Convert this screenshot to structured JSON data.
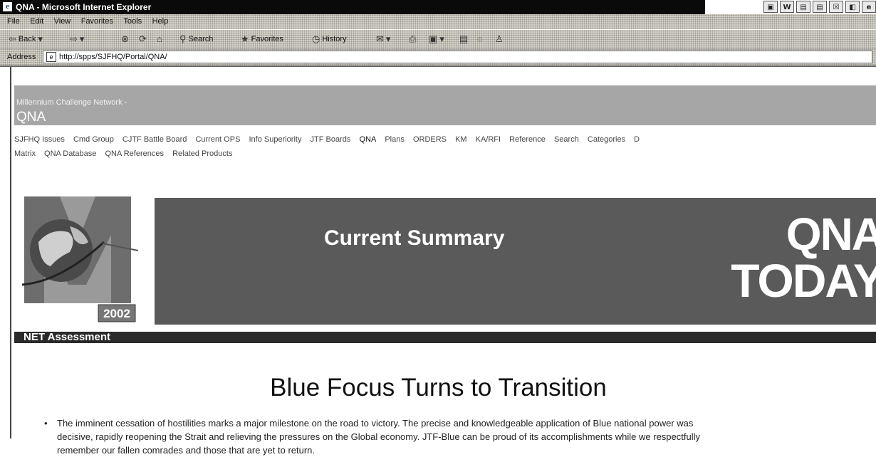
{
  "window": {
    "title": "QNA - Microsoft Internet Explorer",
    "ie_icon": "e",
    "controls": [
      "▣",
      "W",
      "▤",
      "▤",
      "☒",
      "◧",
      "e"
    ]
  },
  "menu": [
    "File",
    "Edit",
    "View",
    "Favorites",
    "Tools",
    "Help"
  ],
  "toolbar": {
    "back": "Back",
    "search": "Search",
    "favorites": "Favorites",
    "history": "History"
  },
  "address": {
    "label": "Address",
    "url": "http://spps/SJFHQ/Portal/QNA/"
  },
  "site": {
    "network": "Millennium Challenge Network -",
    "name": "QNA"
  },
  "nav": {
    "row1": [
      "SJFHQ Issues",
      "Cmd Group",
      "CJTF Battle Board",
      "Current OPS",
      "Info Superiority",
      "JTF Boards",
      "QNA",
      "Plans",
      "ORDERS",
      "KM",
      "KA/RFI",
      "Reference",
      "Search",
      "Categories",
      "D"
    ],
    "row2": [
      "Matrix",
      "QNA Database",
      "QNA References",
      "Related Products"
    ],
    "current": "QNA"
  },
  "logo": {
    "year": "2002"
  },
  "banner": {
    "title": "Current Summary",
    "logo_line1": "QNA",
    "logo_line2": "TODAY"
  },
  "section": {
    "title": "NET Assessment"
  },
  "headline": "Blue Focus Turns to Transition",
  "bullets": [
    {
      "lines": [
        "The imminent cessation of hostilities marks a major milestone on the road to victory.  The precise and knowledgeable application of Blue national power was",
        "decisive, rapidly reopening the Strait and relieving the pressures on the Global economy.  JTF-Blue can be proud of its accomplishments while we respectfully",
        "remember our fallen comrades and those that are yet to return."
      ]
    }
  ]
}
